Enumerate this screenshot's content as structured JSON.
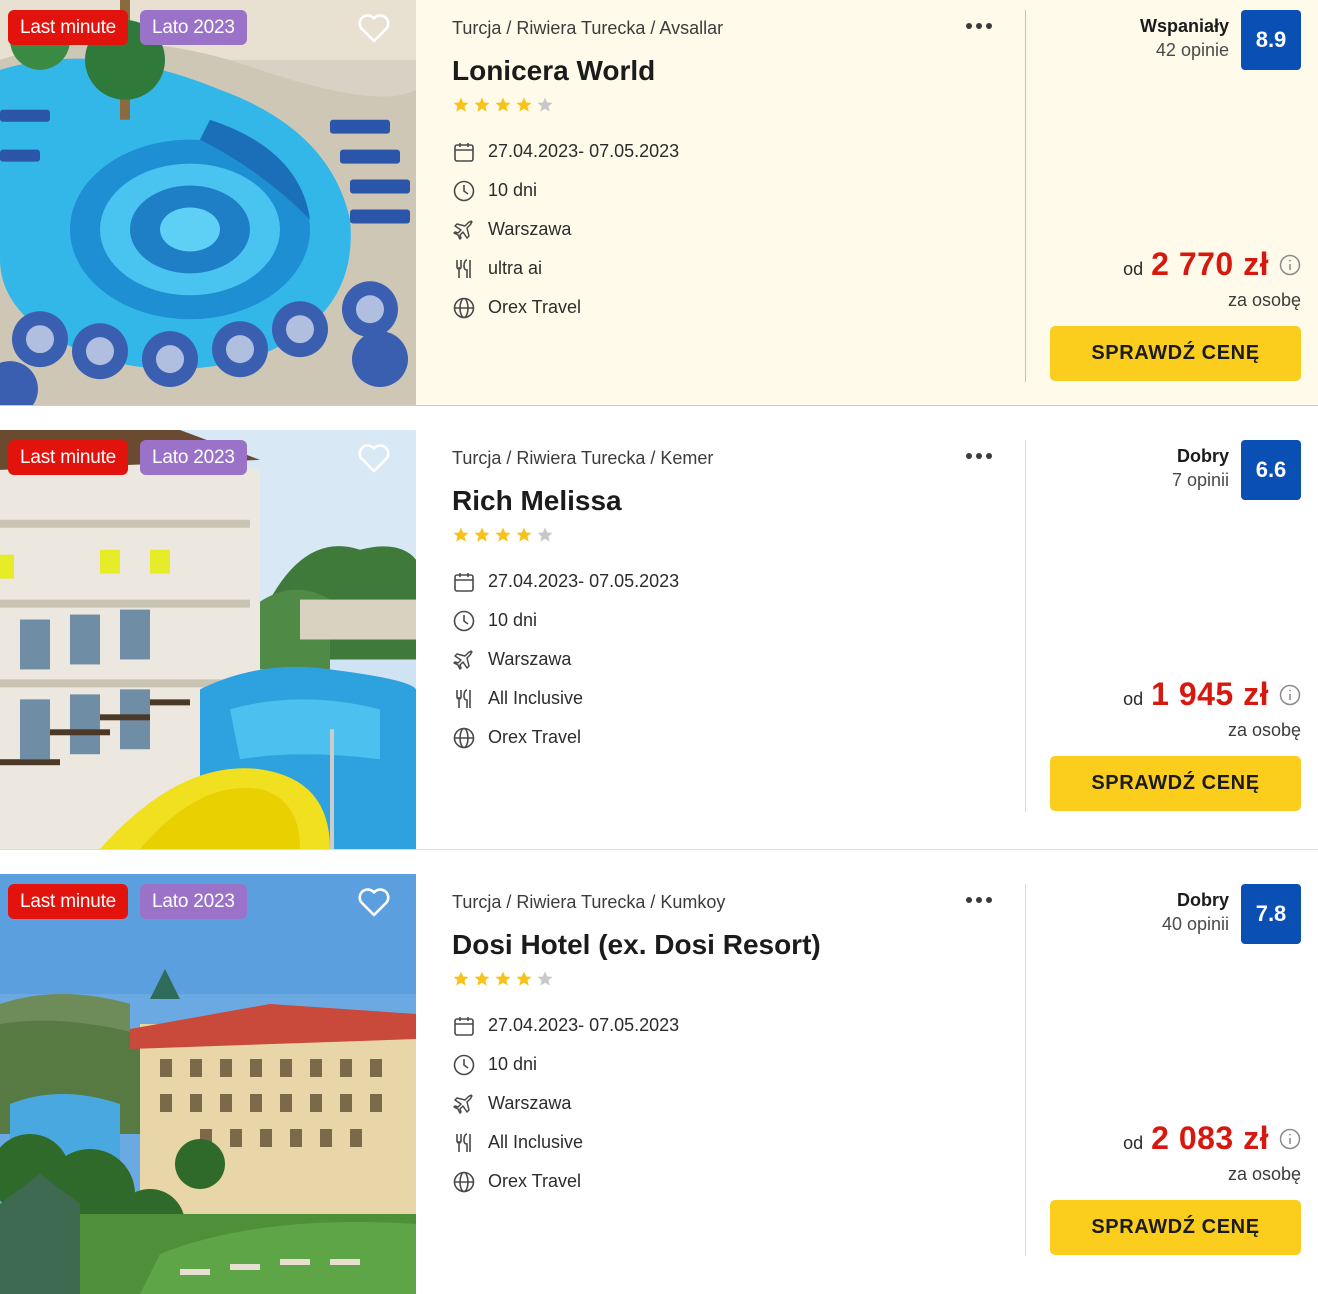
{
  "listings": [
    {
      "badges": [
        "Last minute",
        "Lato 2023"
      ],
      "breadcrumb": "Turcja / Riwiera Turecka / Avsallar",
      "name": "Lonicera World",
      "stars": 4,
      "max_stars": 5,
      "dates": "27.04.2023- 07.05.2023",
      "duration": "10 dni",
      "departure": "Warszawa",
      "board": "ultra ai",
      "operator": "Orex Travel",
      "rating_word": "Wspaniały",
      "rating_count": "42 opinie",
      "score": "8.9",
      "price_prefix": "od",
      "price": "2 770 zł",
      "price_note": "za osobę",
      "cta_label": "SPRAWDŹ CENĘ"
    },
    {
      "badges": [
        "Last minute",
        "Lato 2023"
      ],
      "breadcrumb": "Turcja / Riwiera Turecka / Kemer",
      "name": "Rich Melissa",
      "stars": 4,
      "max_stars": 5,
      "dates": "27.04.2023- 07.05.2023",
      "duration": "10 dni",
      "departure": "Warszawa",
      "board": "All Inclusive",
      "operator": "Orex Travel",
      "rating_word": "Dobry",
      "rating_count": "7 opinii",
      "score": "6.6",
      "price_prefix": "od",
      "price": "1 945 zł",
      "price_note": "za osobę",
      "cta_label": "SPRAWDŹ CENĘ"
    },
    {
      "badges": [
        "Last minute",
        "Lato 2023"
      ],
      "breadcrumb": "Turcja / Riwiera Turecka / Kumkoy",
      "name": "Dosi Hotel (ex. Dosi Resort)",
      "stars": 4,
      "max_stars": 5,
      "dates": "27.04.2023- 07.05.2023",
      "duration": "10 dni",
      "departure": "Warszawa",
      "board": "All Inclusive",
      "operator": "Orex Travel",
      "rating_word": "Dobry",
      "rating_count": "40 opinii",
      "score": "7.8",
      "price_prefix": "od",
      "price": "2 083 zł",
      "price_note": "za osobę",
      "cta_label": "SPRAWDŹ CENĘ"
    }
  ],
  "colors": {
    "last_minute_badge": "#e2120c",
    "season_badge": "#9a72c8",
    "score_box": "#0a4fb3",
    "price": "#d7180f",
    "cta": "#fbcd1c",
    "highlight_bg": "#fffaea",
    "star_on": "#f7c31a",
    "star_off": "#c8c8c8"
  },
  "icons": {
    "dates": "calendar-icon",
    "duration": "clock-icon",
    "departure": "plane-icon",
    "board": "cutlery-icon",
    "operator": "globe-icon",
    "favorite": "heart-icon",
    "more": "more-dots-icon",
    "price_info": "info-icon"
  }
}
